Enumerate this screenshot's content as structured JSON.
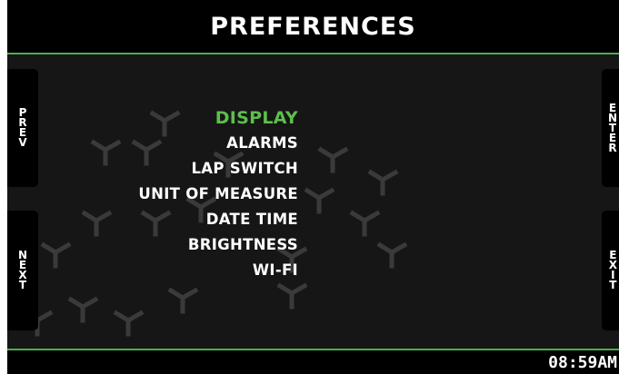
{
  "header": {
    "title": "PREFERENCES"
  },
  "buttons": {
    "prev": "P\nR\nE\nV",
    "next": "N\nE\nX\nT",
    "enter": "E\nN\nT\nE\nR",
    "exit": "E\nX\nI\nT"
  },
  "menu": {
    "items": [
      {
        "label": "DISPLAY",
        "selected": true
      },
      {
        "label": "ALARMS",
        "selected": false
      },
      {
        "label": "LAP SWITCH",
        "selected": false
      },
      {
        "label": "UNIT OF MEASURE",
        "selected": false
      },
      {
        "label": "DATE TIME",
        "selected": false
      },
      {
        "label": "BRIGHTNESS",
        "selected": false
      },
      {
        "label": "WI-FI",
        "selected": false
      }
    ]
  },
  "footer": {
    "clock": "08:59AM"
  },
  "colors": {
    "accent": "#4caf50",
    "selected_text": "#5cbf4c",
    "background": "#141414",
    "text": "#ffffff"
  }
}
